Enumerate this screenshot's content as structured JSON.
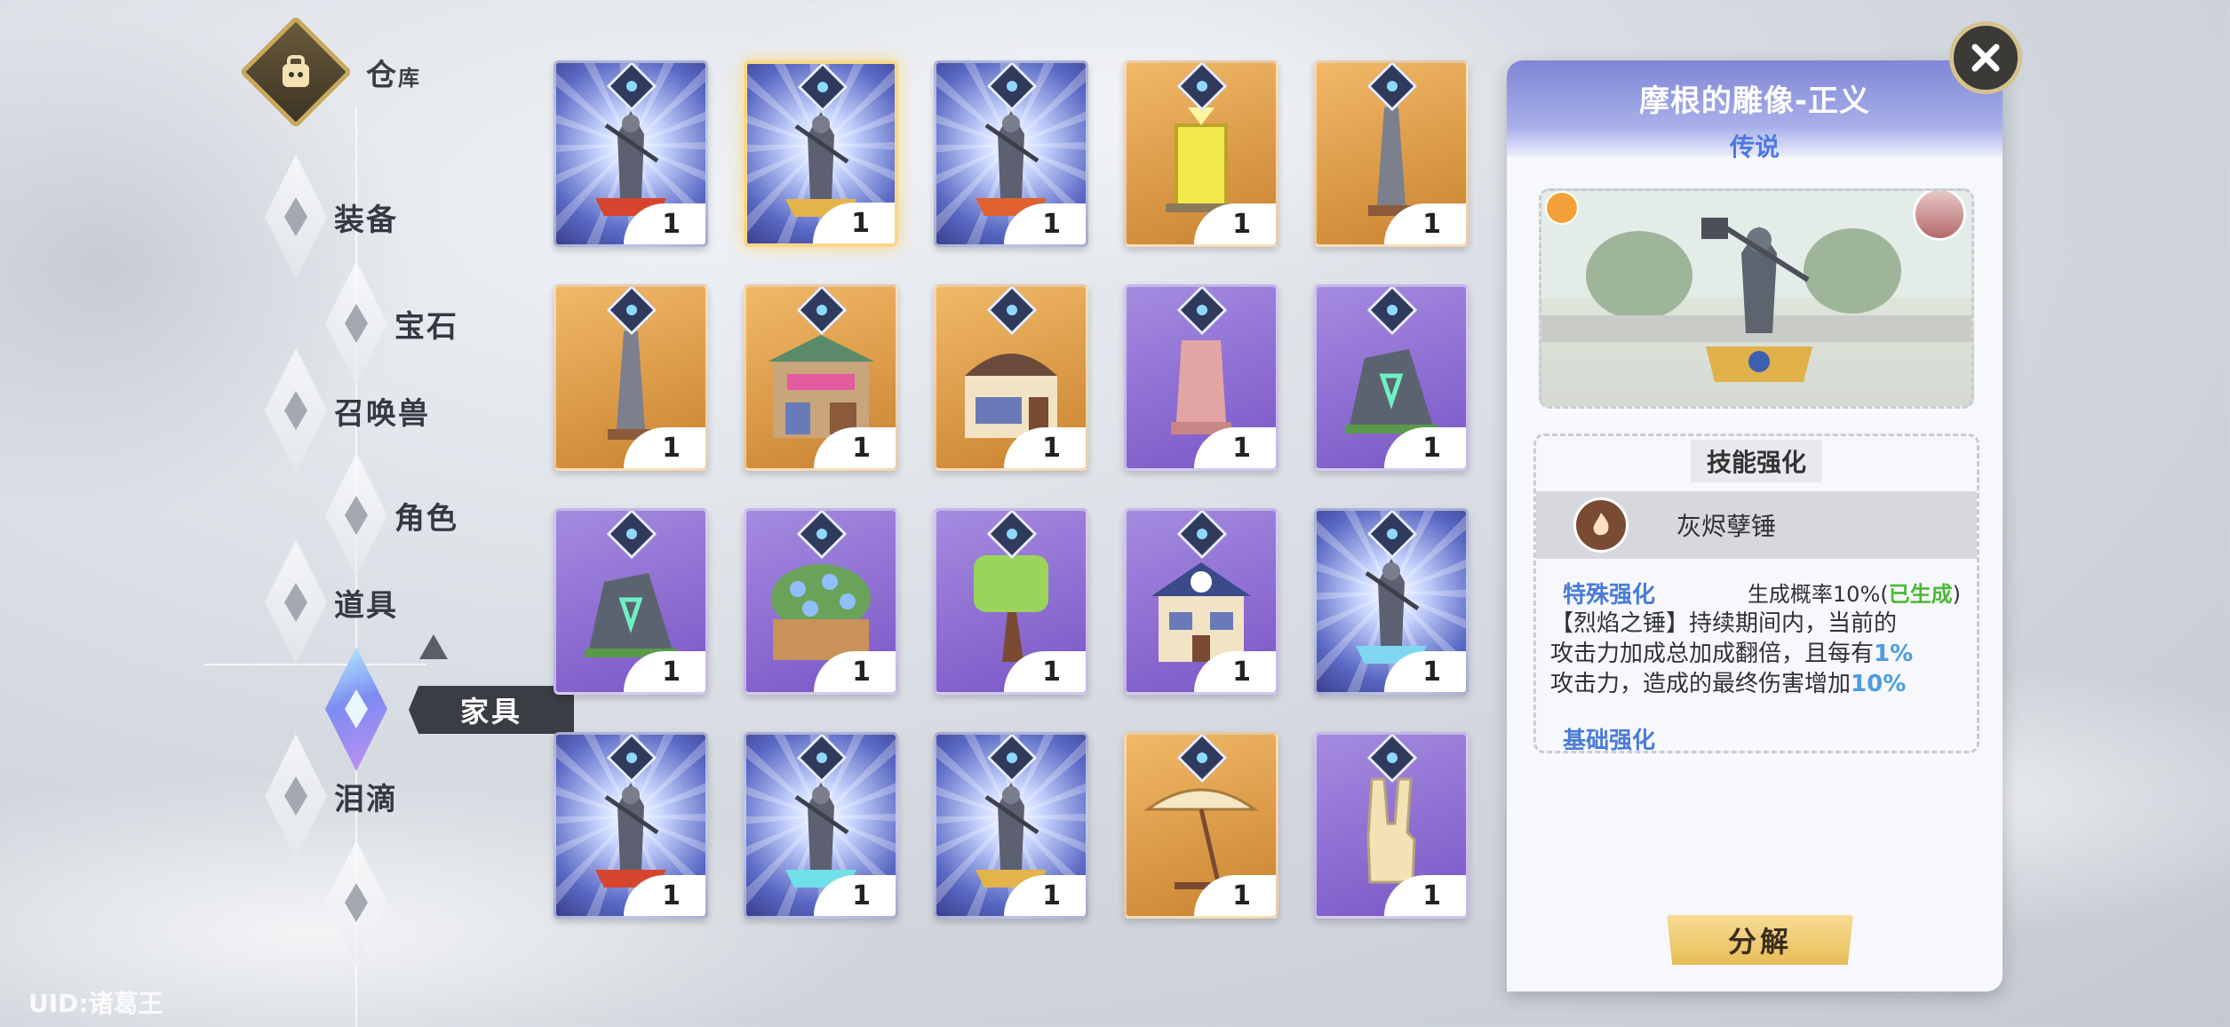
{
  "warehouse": {
    "title_big": "仓",
    "title_small": "库"
  },
  "nav": {
    "items": [
      {
        "label": "装备"
      },
      {
        "label": "宝石"
      },
      {
        "label": "召唤兽"
      },
      {
        "label": "角色"
      },
      {
        "label": "道具"
      },
      {
        "label": "家具"
      },
      {
        "label": "泪滴"
      }
    ],
    "active_label": "家具"
  },
  "uid_text": "UID:诸葛王",
  "grid": {
    "items": [
      {
        "rarity": "blue",
        "art": "statue-red-base",
        "count": "1"
      },
      {
        "rarity": "blue",
        "art": "statue-gold-base",
        "count": "1",
        "selected": true
      },
      {
        "rarity": "blue",
        "art": "statue-fire-base",
        "count": "1"
      },
      {
        "rarity": "gold",
        "art": "gold-pillar",
        "count": "1"
      },
      {
        "rarity": "gold",
        "art": "obelisk",
        "count": "1"
      },
      {
        "rarity": "gold",
        "art": "obelisk",
        "count": "1"
      },
      {
        "rarity": "gold",
        "art": "shop-building",
        "count": "1"
      },
      {
        "rarity": "gold",
        "art": "dome-building",
        "count": "1"
      },
      {
        "rarity": "purple",
        "art": "pink-rock",
        "count": "1"
      },
      {
        "rarity": "purple",
        "art": "rune-rock",
        "count": "1"
      },
      {
        "rarity": "purple",
        "art": "rune-rock",
        "count": "1"
      },
      {
        "rarity": "purple",
        "art": "flower-box",
        "count": "1"
      },
      {
        "rarity": "purple",
        "art": "bonsai-tree",
        "count": "1"
      },
      {
        "rarity": "purple",
        "art": "house",
        "count": "1"
      },
      {
        "rarity": "blue",
        "art": "statue-ice-base",
        "count": "1"
      },
      {
        "rarity": "blue",
        "art": "statue-red-base",
        "count": "1"
      },
      {
        "rarity": "blue",
        "art": "statue-cyan-base",
        "count": "1"
      },
      {
        "rarity": "blue",
        "art": "statue-gold-base",
        "count": "1"
      },
      {
        "rarity": "gold",
        "art": "parasol",
        "count": "1"
      },
      {
        "rarity": "purple",
        "art": "victory-hand",
        "count": "1"
      }
    ]
  },
  "detail": {
    "title": "摩根的雕像-正义",
    "rarity": "传说",
    "skill_tab": "技能强化",
    "skill_name": "灰烬孽锤",
    "special_label": "特殊强化",
    "rate_text": "生成概率10%(",
    "rate_status": "已生成",
    "rate_close": ")",
    "desc_line1": "【烈焰之锤】持续期间内，当前的",
    "desc_line2_a": "攻击力加成总加成翻倍，且每有",
    "desc_line2_b": "1%",
    "desc_line3_a": "攻击力，造成的最终伤害增加",
    "desc_line3_b": "10%",
    "base_label": "基础强化",
    "decompose_label": "分解"
  },
  "colors": {
    "rarity_blue": "#5a69c4",
    "rarity_gold": "#d9974a",
    "rarity_purple": "#8d6bd3",
    "legend_text": "#4c7ae0",
    "generated_green": "#49b936",
    "highlight_blue": "#4a9de0"
  }
}
